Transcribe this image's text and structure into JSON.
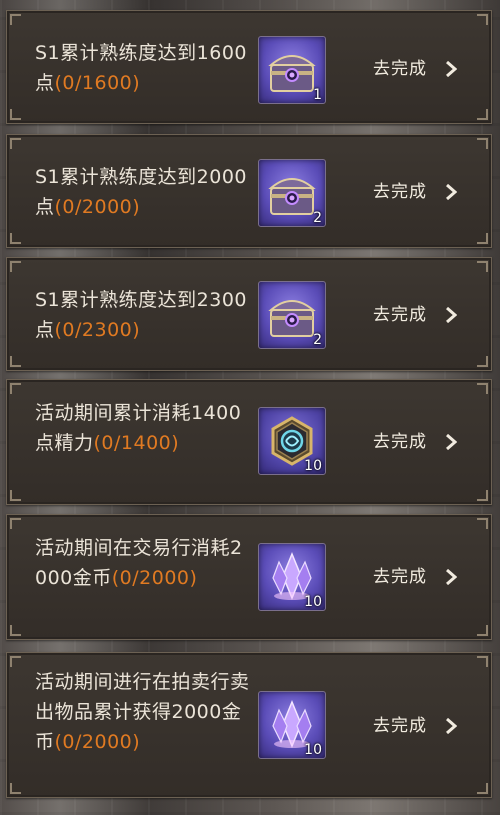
{
  "tasks": [
    {
      "text": "S1累计熟练度达到1600点",
      "progress": "(0/1600)",
      "reward_icon": "purple-chest-icon",
      "reward_count": "1",
      "button_label": "去完成"
    },
    {
      "text": "S1累计熟练度达到2000点",
      "progress": "(0/2000)",
      "reward_icon": "purple-chest-icon",
      "reward_count": "2",
      "button_label": "去完成"
    },
    {
      "text": "S1累计熟练度达到2300点",
      "progress": "(0/2300)",
      "reward_icon": "purple-chest-icon",
      "reward_count": "2",
      "button_label": "去完成"
    },
    {
      "text": "活动期间累计消耗1400点精力",
      "progress": "(0/1400)",
      "reward_icon": "hexagon-medal-icon",
      "reward_count": "10",
      "button_label": "去完成"
    },
    {
      "text": "活动期间在交易行消耗2000金币",
      "progress": "(0/2000)",
      "reward_icon": "crystal-icon",
      "reward_count": "10",
      "button_label": "去完成"
    },
    {
      "text": "活动期间进行在拍卖行卖出物品累计获得2000金币",
      "progress": "(0/2000)",
      "reward_icon": "crystal-icon",
      "reward_count": "10",
      "button_label": "去完成"
    }
  ],
  "colors": {
    "progress": "#e07a22",
    "text": "#ebe4d8",
    "card": "#3a342e",
    "border": "#6c6153"
  }
}
